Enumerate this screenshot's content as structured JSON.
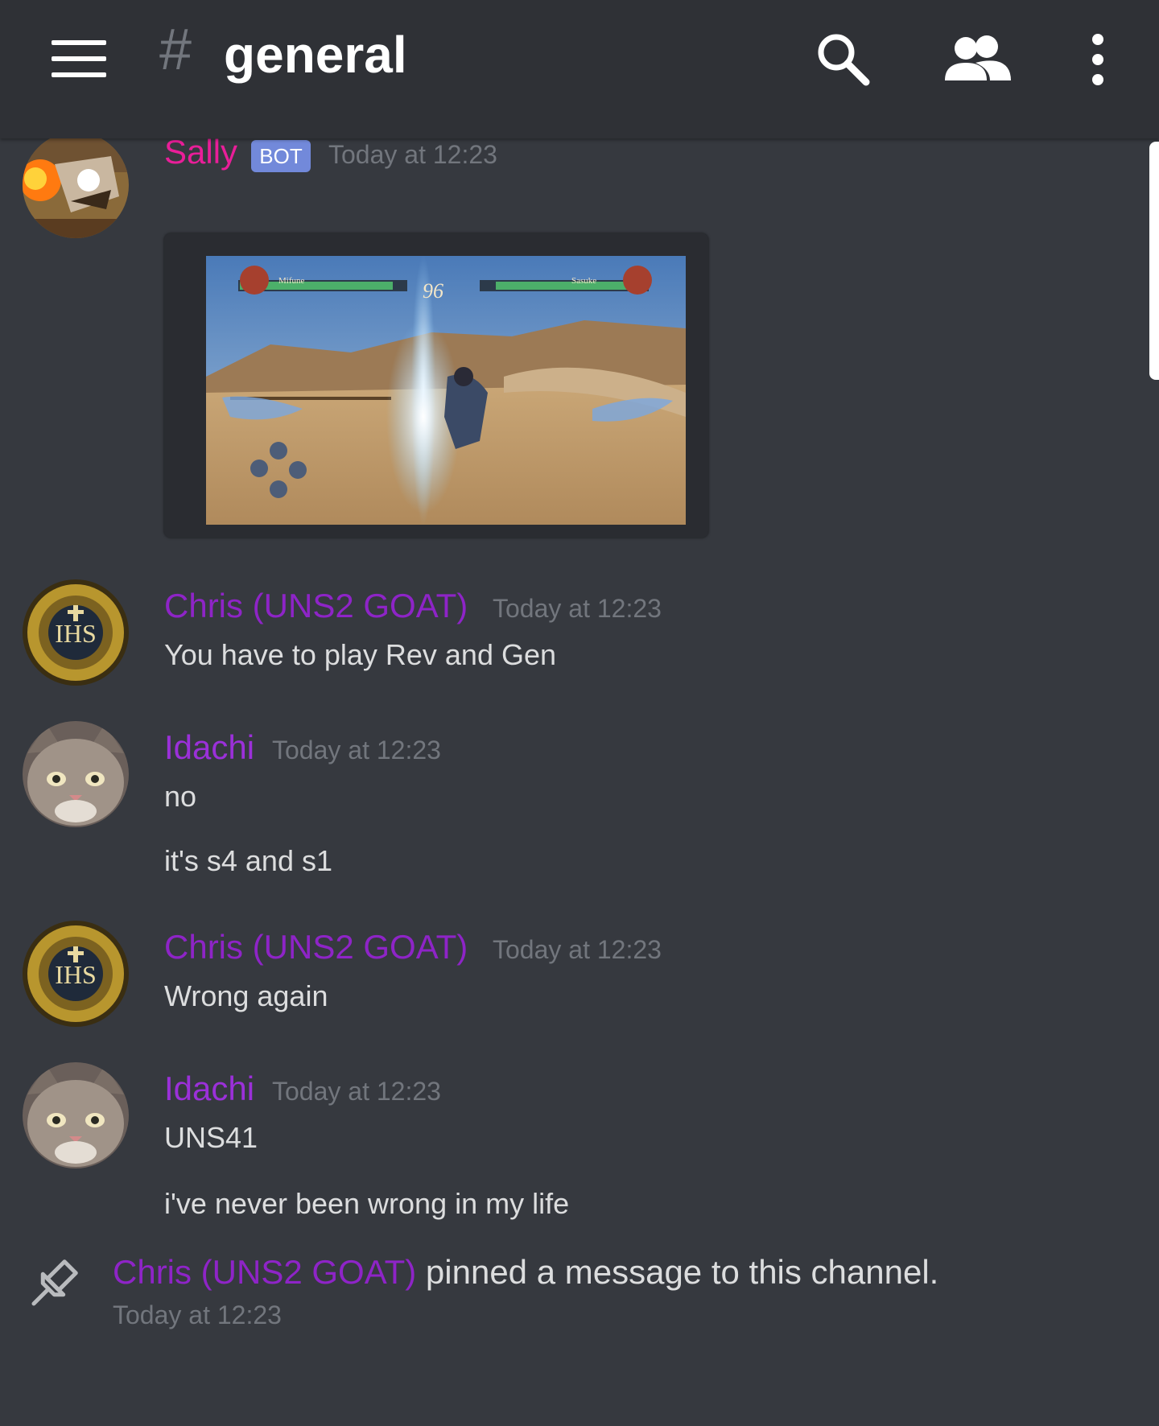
{
  "header": {
    "hash": "#",
    "channel": "general",
    "icons": [
      "hamburger-icon",
      "search-icon",
      "members-icon",
      "more-icon"
    ]
  },
  "colors": {
    "background": "#36393f",
    "header": "#2f3136",
    "sally": "#e91e99",
    "chris": "#8e24c7",
    "idachi": "#9b30d9",
    "timestamp": "#72767d",
    "bot_badge": "#7289da"
  },
  "messages": [
    {
      "author": "Sally",
      "bot_label": "BOT",
      "time": "Today at 12:23",
      "attachment": "gameplay-screenshot",
      "attachment_hud": {
        "timer": "96",
        "p1": "Mifune",
        "p2": "Sasuke"
      }
    },
    {
      "author": "Chris (UNS2 GOAT)",
      "time": "Today at 12:23",
      "lines": [
        "You have to play Rev and Gen"
      ]
    },
    {
      "author": "Idachi",
      "time": "Today at 12:23",
      "lines": [
        "no",
        "it's s4 and s1"
      ]
    },
    {
      "author": "Chris (UNS2 GOAT)",
      "time": "Today at 12:23",
      "lines": [
        "Wrong again"
      ]
    },
    {
      "author": "Idachi",
      "time": "Today at 12:23",
      "lines": [
        "UNS41",
        "i've never been wrong in my life"
      ]
    }
  ],
  "system": {
    "actor": "Chris (UNS2 GOAT)",
    "action": "pinned a message to this channel.",
    "time": "Today at 12:23",
    "icon": "pin-icon"
  }
}
